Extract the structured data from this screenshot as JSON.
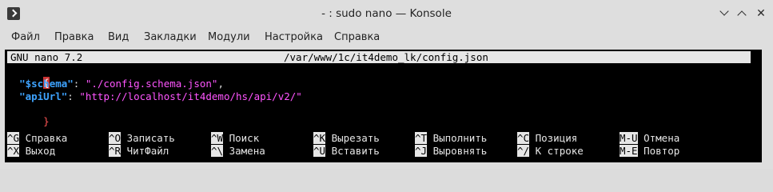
{
  "window": {
    "title": "- : sudo nano — Konsole"
  },
  "menu": [
    "Файл",
    "Правка",
    "Вид",
    "Закладки",
    "Модули",
    "Настройка",
    "Справка"
  ],
  "nano": {
    "version": "GNU nano 7.2",
    "filepath": "/var/www/1c/it4demo_lk/config.json",
    "lines": [
      {
        "open": "{"
      },
      {
        "key": "\"$schema\"",
        "sep": ": ",
        "value": "\"./config.schema.json\"",
        "end": ","
      },
      {
        "key": "\"apiUrl\"",
        "sep": ": ",
        "value": "\"http://localhost/it4demo/hs/api/v2/\"",
        "end": ""
      },
      {
        "close": "}"
      }
    ],
    "shortcuts_row1": [
      {
        "key": "^G",
        "label": "Справка"
      },
      {
        "key": "^O",
        "label": "Записать"
      },
      {
        "key": "^W",
        "label": "Поиск"
      },
      {
        "key": "^K",
        "label": "Вырезать"
      },
      {
        "key": "^T",
        "label": "Выполнить"
      },
      {
        "key": "^C",
        "label": "Позиция"
      },
      {
        "key": "M-U",
        "label": "Отмена"
      }
    ],
    "shortcuts_row2": [
      {
        "key": "^X",
        "label": "Выход"
      },
      {
        "key": "^R",
        "label": "ЧитФайл"
      },
      {
        "key": "^\\",
        "label": "Замена"
      },
      {
        "key": "^U",
        "label": "Вставить"
      },
      {
        "key": "^J",
        "label": "Выровнять"
      },
      {
        "key": "^/",
        "label": "К строке"
      },
      {
        "key": "M-E",
        "label": "Повтор"
      }
    ]
  },
  "colors": {
    "terminal_bg": "#000000",
    "json_key": "#3ea3ff",
    "json_string": "#ff55ff",
    "brace": "#ff5555"
  }
}
